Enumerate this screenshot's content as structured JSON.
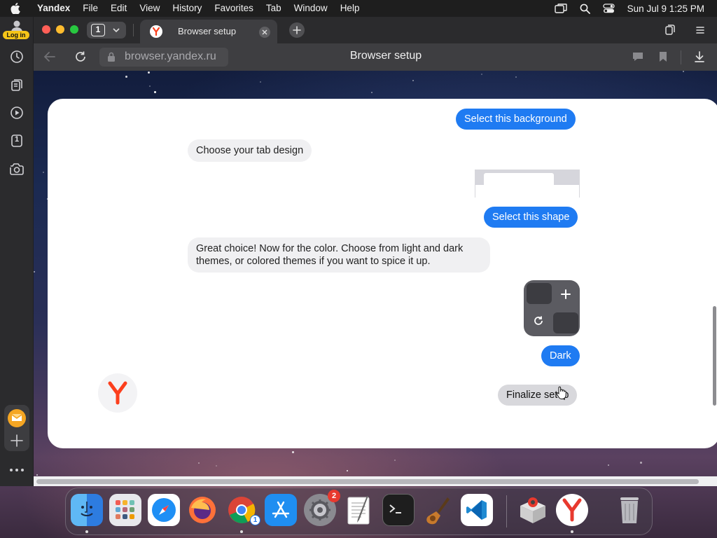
{
  "menubar": {
    "app_name": "Yandex",
    "items": [
      "File",
      "Edit",
      "View",
      "History",
      "Favorites",
      "Tab",
      "Window",
      "Help"
    ],
    "datetime": "Sun Jul 9  1:25 PM"
  },
  "sidebar": {
    "login_label": "Log in",
    "tabs_count_label": "1"
  },
  "tabstrip": {
    "tab_count": "1",
    "active_tab_title": "Browser setup"
  },
  "toolbar": {
    "url": "browser.yandex.ru",
    "page_title": "Browser setup"
  },
  "chat": {
    "select_background": "Select this background",
    "tab_design_prompt": "Choose your tab design",
    "select_shape": "Select this shape",
    "color_prompt": "Great choice! Now for the color. Choose from light and dark themes, or colored themes if you want to spice it up.",
    "theme_choice": "Dark",
    "finalize_button": "Finalize setup"
  },
  "dock": {
    "apps": [
      "Finder",
      "Launchpad",
      "Safari",
      "Firefox",
      "Chrome",
      "App Store",
      "System Settings",
      "TextEdit",
      "Terminal",
      "Instruments",
      "Visual Studio Code",
      "Remote Desktop",
      "Yandex Browser",
      "Trash"
    ],
    "system_settings_badge": "2",
    "chrome_badge": "1"
  },
  "colors": {
    "accent_blue": "#1f7bf2",
    "yandex_red": "#fc3f1d",
    "login_yellow": "#f5c518"
  }
}
